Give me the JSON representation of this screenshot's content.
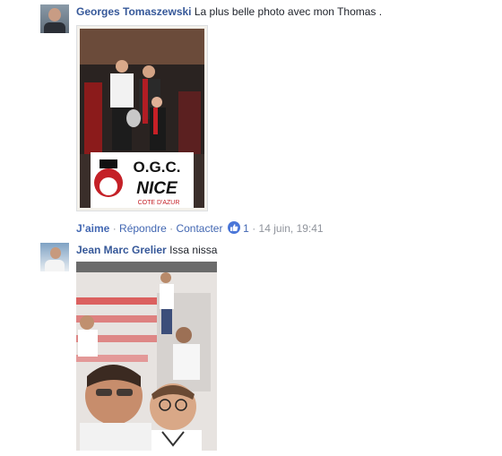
{
  "comments": [
    {
      "author": "Georges Tomaszewski",
      "text": "La plus belle photo avec mon Thomas .",
      "photo": {
        "banner_line1": "O.G.C.",
        "banner_line2": "NICE",
        "banner_line3": "COTE D'AZUR"
      },
      "actions": {
        "like": "J’aime",
        "reply": "Répondre",
        "contact": "Contacter",
        "separator": "·",
        "like_count": "1",
        "date": "14 juin, 19:41"
      }
    },
    {
      "author": "Jean Marc Grelier",
      "text": "Issa nissa"
    }
  ],
  "colors": {
    "link": "#365899",
    "action_link": "#4267b2",
    "meta": "#90949c",
    "like_badge": "#4a76d8"
  },
  "icons": {
    "like_badge": "thumbs-up-icon"
  }
}
